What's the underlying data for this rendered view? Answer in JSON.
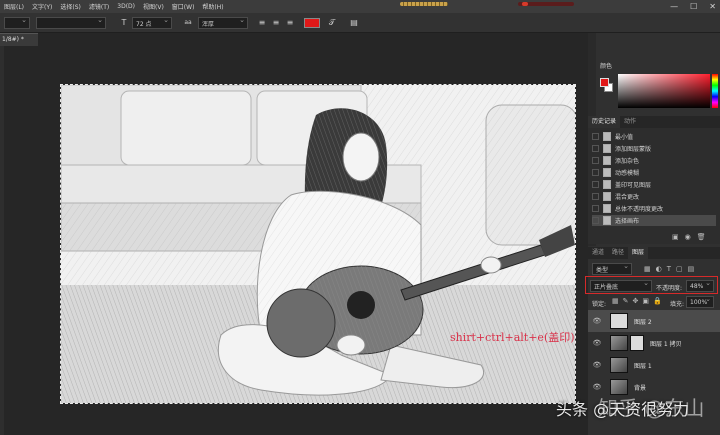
{
  "menu": [
    "图层(L)",
    "文字(Y)",
    "选择(S)",
    "滤镜(T)",
    "3D(D)",
    "视图(V)",
    "窗口(W)",
    "帮助(H)"
  ],
  "window_controls": [
    "—",
    "☐",
    "✕"
  ],
  "options": {
    "font_size": "72 点",
    "aa_icon": "aa",
    "aa_mode": "浑厚",
    "text_color": "#e01818"
  },
  "doc_tab": "1/8#) *",
  "color_panel": {
    "title": "颜色",
    "fg": "#e01818",
    "bg": "#ffffff"
  },
  "history": {
    "tabs": [
      "历史记录",
      "动作"
    ],
    "items": [
      "最小值",
      "添加图层蒙版",
      "添加杂色",
      "动感模糊",
      "盖印可见图层",
      "混合更改",
      "总体不透明度更改",
      "选择画布"
    ],
    "selected_index": 7
  },
  "layers": {
    "tabs": [
      "通道",
      "路径",
      "图层"
    ],
    "filter_label": "类型",
    "blend_mode": "正片叠底",
    "opacity_label": "不透明度:",
    "opacity_value": "48%",
    "lock_label": "锁定:",
    "fill_label": "填充:",
    "fill_value": "100%",
    "items": [
      "图层 2",
      "图层 1 拷贝",
      "图层 1",
      "背景"
    ],
    "selected_index": 0
  },
  "canvas_annotation": "shirt+ctrl+alt+e(盖印)",
  "watermark": "头条 @天资很努力",
  "watermark_zhihu": "知乎 @东山",
  "accent": "#d62a2a"
}
